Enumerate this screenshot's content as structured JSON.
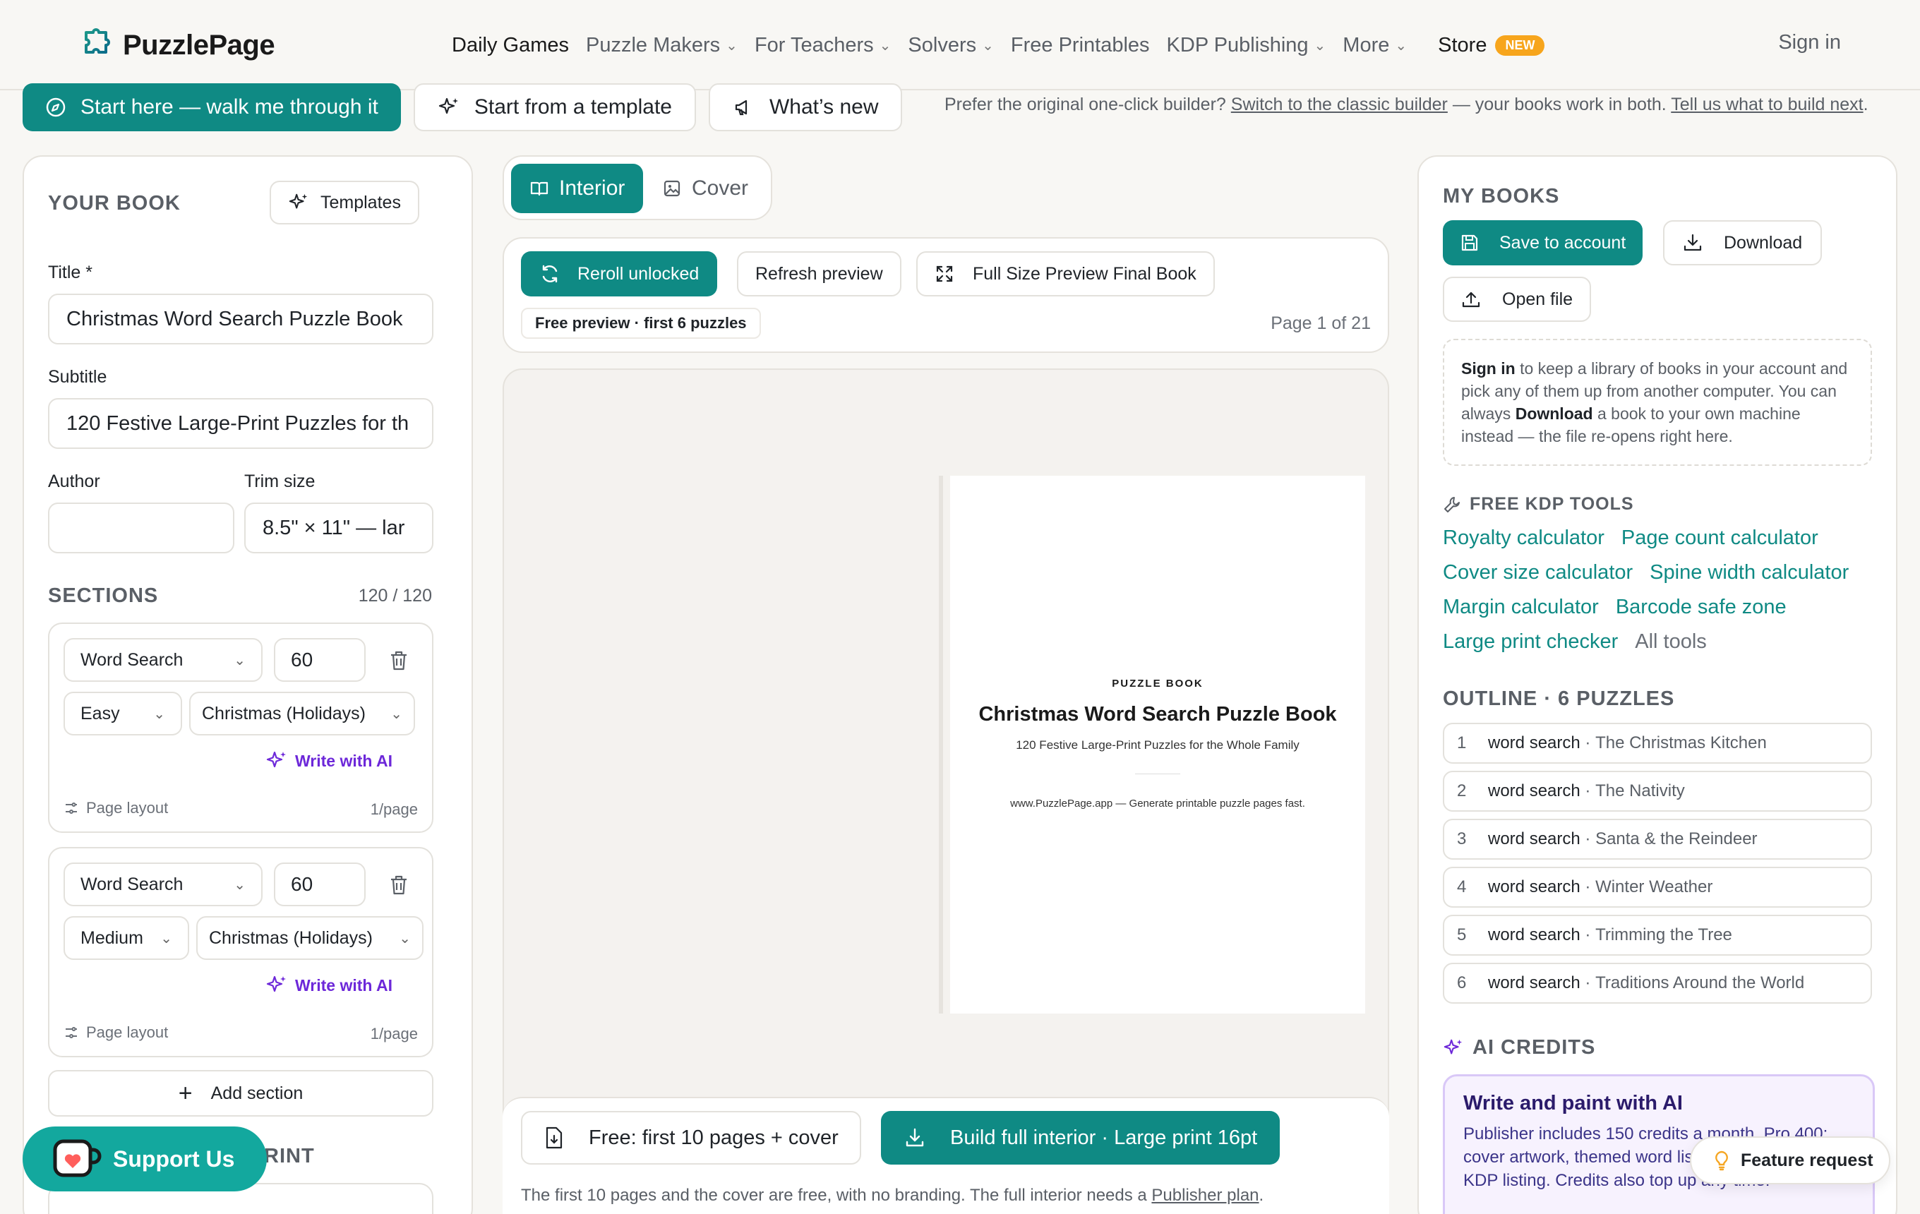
{
  "brand": {
    "name": "PuzzlePage",
    "accent": "#0f8a84",
    "ai_color": "#6d28d9"
  },
  "nav": {
    "items": [
      {
        "label": "Daily Games",
        "dropdown": false,
        "dark": true
      },
      {
        "label": "Puzzle Makers",
        "dropdown": true
      },
      {
        "label": "For Teachers",
        "dropdown": true
      },
      {
        "label": "Solvers",
        "dropdown": true
      },
      {
        "label": "Free Printables",
        "dropdown": false
      },
      {
        "label": "KDP Publishing",
        "dropdown": true
      },
      {
        "label": "More",
        "dropdown": true
      }
    ],
    "store": "Store",
    "store_badge": "NEW",
    "signin": "Sign in"
  },
  "actions": {
    "start_here": "Start here — walk me through it",
    "template": "Start from a template",
    "whats_new": "What’s new",
    "note_prefix": "Prefer the original one-click builder?",
    "note_link1": "Switch to the classic builder",
    "note_mid": "— your books work in both.",
    "note_link2": "Tell us what to build next",
    "note_end": "."
  },
  "left": {
    "header": "YOUR BOOK",
    "templates_btn": "Templates",
    "title_label": "Title *",
    "title_value": "Christmas Word Search Puzzle Book",
    "subtitle_label": "Subtitle",
    "subtitle_value": "120 Festive Large-Print Puzzles for th",
    "author_label": "Author",
    "author_value": "",
    "trim_label": "Trim size",
    "trim_value": "8.5\" × 11\" — lar",
    "sections_label": "SECTIONS",
    "sections_count": "120 / 120",
    "sections": [
      {
        "type": "Word Search",
        "count": "60",
        "difficulty": "Easy",
        "theme": "Christmas (Holidays)",
        "ai": "Write with AI",
        "layout_label": "Page layout",
        "layout_value": "1/page"
      },
      {
        "type": "Word Search",
        "count": "60",
        "difficulty": "Medium",
        "theme": "Christmas (Holidays)",
        "ai": "Write with AI",
        "layout_label": "Page layout",
        "layout_value": "1/page"
      }
    ],
    "add_section": "Add section",
    "print_partial": "RINT"
  },
  "center": {
    "tab_interior": "Interior",
    "tab_cover": "Cover",
    "reroll": "Reroll unlocked",
    "refresh": "Refresh preview",
    "full_preview": "Full Size Preview Final Book",
    "free_preview": "Free preview · first 6 puzzles",
    "page_indicator": "Page 1 of 21",
    "page_kicker": "PUZZLE BOOK",
    "page_title": "Christmas Word Search Puzzle Book",
    "page_subtitle": "120 Festive Large-Print Puzzles for the Whole Family",
    "page_footer": "www.PuzzlePage.app — Generate printable puzzle pages fast.",
    "free_btn": "Free: first 10 pages + cover",
    "build_btn": "Build full interior · Large print 16pt",
    "footer_note": "The first 10 pages and the cover are free, with no branding. The full interior needs a",
    "footer_link": "Publisher plan",
    "footer_end": "."
  },
  "right": {
    "my_books": "MY BOOKS",
    "save": "Save to account",
    "download": "Download",
    "open": "Open file",
    "info_signin": "Sign in",
    "info_1": "to keep a library of books in your account and pick any of them up from another computer. You can always",
    "info_download": "Download",
    "info_2": "a book to your own machine instead — the file re-opens right here.",
    "tools_header": "FREE KDP TOOLS",
    "tools": [
      "Royalty calculator",
      "Page count calculator",
      "Cover size calculator",
      "Spine width calculator",
      "Margin calculator",
      "Barcode safe zone",
      "Large print checker"
    ],
    "all_tools": "All tools",
    "outline_header": "OUTLINE · 6 PUZZLES",
    "outline": [
      {
        "n": "1",
        "kind": "word search",
        "title": "The Christmas Kitchen"
      },
      {
        "n": "2",
        "kind": "word search",
        "title": "The Nativity"
      },
      {
        "n": "3",
        "kind": "word search",
        "title": "Santa & the Reindeer"
      },
      {
        "n": "4",
        "kind": "word search",
        "title": "Winter Weather"
      },
      {
        "n": "5",
        "kind": "word search",
        "title": "Trimming the Tree"
      },
      {
        "n": "6",
        "kind": "word search",
        "title": "Traditions Around the World"
      }
    ],
    "ai_header": "AI CREDITS",
    "ai_card_title": "Write and paint with AI",
    "ai_card_body": "Publisher includes 150 credits a month, Pro 400: cover artwork, themed word lists, copy and your KDP listing. Credits also top up any time."
  },
  "support": "Support Us",
  "feature_request": "Feature request"
}
